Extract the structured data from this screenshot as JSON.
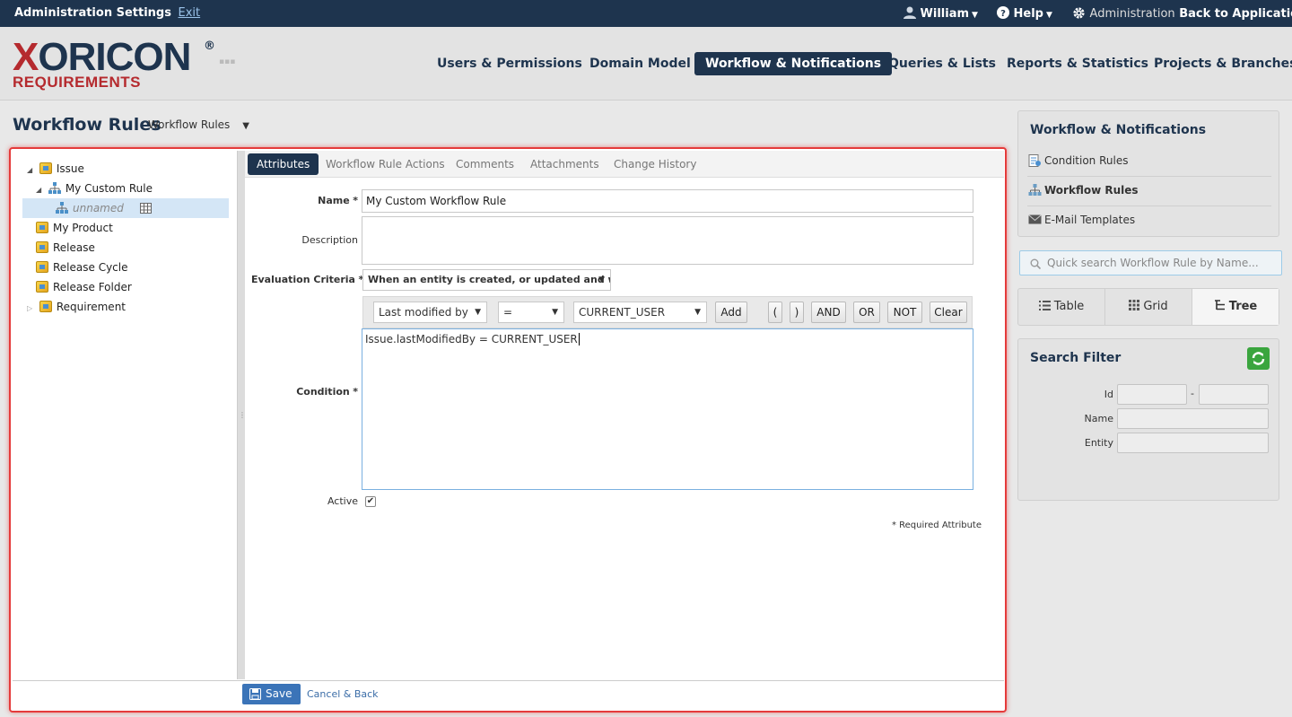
{
  "topbar": {
    "title": "Administration Settings",
    "exit": "Exit",
    "user": "William",
    "help": "Help",
    "administration": "Administration",
    "back": "Back to Application"
  },
  "logo": {
    "main_x": "X",
    "main_rest": "ORICON",
    "reg": "®",
    "sub": "REQUIREMENTS"
  },
  "nav": [
    "Users & Permissions",
    "Domain Model",
    "Workflow & Notifications",
    "Queries & Lists",
    "Reports & Statistics",
    "Projects & Branches"
  ],
  "page": {
    "title": "Workflow Rules",
    "selector": "Workflow Rules"
  },
  "tree": {
    "issue": "Issue",
    "custom_rule": "My Custom Rule",
    "unnamed": "unnamed",
    "my_product": "My Product",
    "release": "Release",
    "release_cycle": "Release Cycle",
    "release_folder": "Release Folder",
    "requirement": "Requirement"
  },
  "tabs": [
    "Attributes",
    "Workflow Rule Actions",
    "Comments",
    "Attachments",
    "Change History"
  ],
  "form": {
    "name_label": "Name",
    "name_value": "My Custom Workflow Rule",
    "description_label": "Description",
    "eval_label": "Evaluation Criteria",
    "eval_value": "When an entity is created, or updated and workfl",
    "condition_label": "Condition",
    "req_star": "*",
    "field_select": "Last modified by",
    "op_select": "=",
    "value_select": "CURRENT_USER",
    "add": "Add",
    "open_paren": "(",
    "close_paren": ")",
    "and": "AND",
    "or": "OR",
    "not": "NOT",
    "clear": "Clear",
    "condition_text": "Issue.lastModifiedBy = CURRENT_USER",
    "active_label": "Active",
    "active_checked": true,
    "required_note": "* Required Attribute"
  },
  "bottom": {
    "save": "Save",
    "cancel": "Cancel & Back"
  },
  "right": {
    "panel_title": "Workflow & Notifications",
    "items": [
      "Condition Rules",
      "Workflow Rules",
      "E-Mail Templates"
    ],
    "quick_search": "Quick search Workflow Rule by Name...",
    "views": [
      "Table",
      "Grid",
      "Tree"
    ],
    "filter_title": "Search Filter",
    "filter_id": "Id",
    "filter_dash": "-",
    "filter_name": "Name",
    "filter_entity": "Entity"
  },
  "colors": {
    "navy": "#1e344e",
    "brand_red": "#b52a2e",
    "highlight": "#e53b3b",
    "save_blue": "#3b74b8",
    "refresh_green": "#3aa53e"
  }
}
